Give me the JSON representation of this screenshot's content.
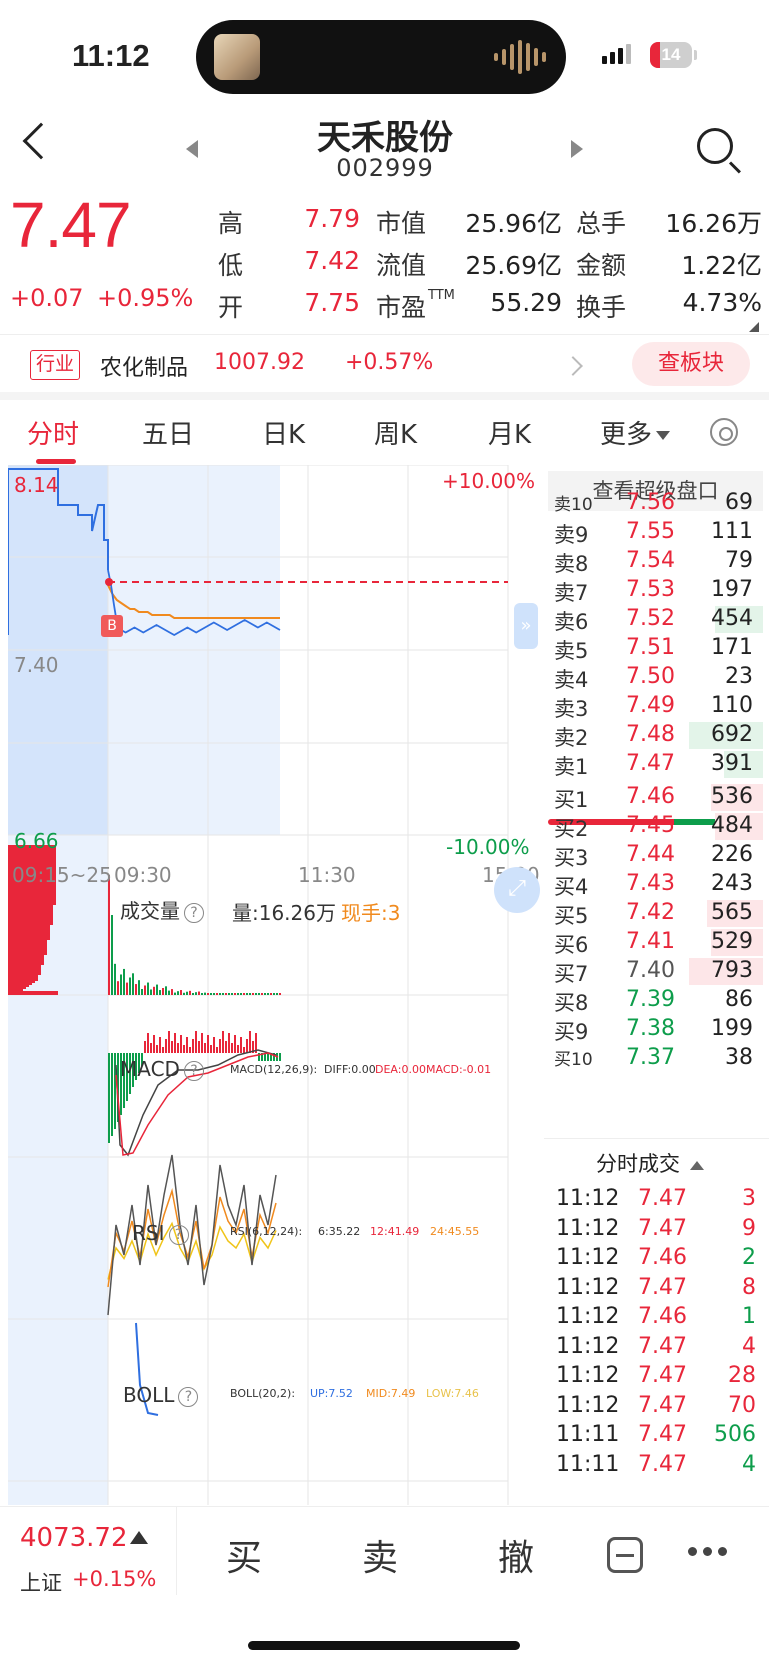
{
  "status": {
    "time": "11:12",
    "battery": "14"
  },
  "header": {
    "title": "天禾股份",
    "code": "002999"
  },
  "quote": {
    "price": "7.47",
    "change": "+0.07",
    "change_pct": "+0.95%",
    "high_label": "高",
    "high": "7.79",
    "low_label": "低",
    "low": "7.42",
    "open_label": "开",
    "open": "7.75",
    "mktcap_label": "市值",
    "mktcap": "25.96亿",
    "float_label": "流值",
    "float": "25.69亿",
    "pe_label": "市盈",
    "pe_sup": "TTM",
    "pe": "55.29",
    "vol_label": "总手",
    "vol": "16.26万",
    "amount_label": "金额",
    "amount": "1.22亿",
    "turnover_label": "换手",
    "turnover": "4.73%"
  },
  "industry": {
    "tag": "行业",
    "name": "农化制品",
    "value": "1007.92",
    "pct": "+0.57%",
    "button": "查板块"
  },
  "tabs": [
    "分时",
    "五日",
    "日K",
    "周K",
    "月K",
    "更多"
  ],
  "chart": {
    "price_top": "8.14",
    "price_mid": "7.40",
    "price_bottom": "6.66",
    "pct_top": "+10.00%",
    "pct_bottom": "-10.00%",
    "time_labels": [
      "09:15~25",
      "09:30",
      "11:30",
      "15:00"
    ],
    "marker": "B",
    "volume_title": "成交量",
    "volume_text": "量:16.26万",
    "now_hand": "现手:3",
    "macd_title": "MACD",
    "macd_params": "MACD(12,26,9):",
    "macd_diff": "DIFF:0.00",
    "macd_dea": "DEA:0.00",
    "macd_val": "MACD:-0.01",
    "rsi_title": "RSI",
    "rsi_params": "RSI(6,12,24):",
    "rsi6": "6:35.22",
    "rsi12": "12:41.49",
    "rsi24": "24:45.55",
    "boll_title": "BOLL",
    "boll_params": "BOLL(20,2):",
    "boll_up": "UP:7.52",
    "boll_mid": "MID:7.49",
    "boll_low": "LOW:7.46",
    "help": "?"
  },
  "chart_data": {
    "type": "line",
    "price_series": [
      7.4,
      7.44,
      7.43,
      7.42,
      7.41,
      7.42,
      7.43,
      7.42,
      7.41,
      7.42,
      7.43,
      7.44,
      7.43,
      7.42,
      7.41,
      7.4,
      7.41,
      7.42,
      7.43,
      7.42,
      7.41,
      7.42,
      7.43,
      7.44,
      7.45,
      7.44,
      7.43,
      7.42,
      7.43,
      7.44,
      7.45,
      7.46,
      7.45,
      7.44,
      7.43,
      7.44,
      7.45,
      7.44,
      7.43,
      7.42
    ],
    "avg_series": [
      7.58,
      7.55,
      7.53,
      7.52,
      7.51,
      7.5,
      7.5,
      7.49,
      7.49,
      7.49,
      7.48,
      7.48,
      7.48,
      7.48,
      7.48,
      7.47,
      7.47,
      7.47,
      7.47,
      7.47,
      7.47,
      7.47,
      7.47,
      7.47,
      7.47,
      7.47,
      7.47,
      7.47,
      7.47,
      7.47,
      7.47,
      7.47,
      7.47,
      7.47,
      7.47,
      7.47,
      7.47,
      7.47,
      7.47,
      7.47
    ],
    "prev_close": 7.4,
    "ylim": [
      6.66,
      8.14
    ]
  },
  "book": {
    "head": "查看超级盘口",
    "asks": [
      {
        "label": "卖10",
        "price": "7.56",
        "vol": "69",
        "color": "red",
        "bar": 0.0
      },
      {
        "label": "卖9",
        "price": "7.55",
        "vol": "111",
        "color": "red",
        "bar": 0.0
      },
      {
        "label": "卖8",
        "price": "7.54",
        "vol": "79",
        "color": "red",
        "bar": 0.0
      },
      {
        "label": "卖7",
        "price": "7.53",
        "vol": "197",
        "color": "red",
        "bar": 0.0
      },
      {
        "label": "卖6",
        "price": "7.52",
        "vol": "454",
        "color": "red",
        "bar": 0.22
      },
      {
        "label": "卖5",
        "price": "7.51",
        "vol": "171",
        "color": "red",
        "bar": 0.0
      },
      {
        "label": "卖4",
        "price": "7.50",
        "vol": "23",
        "color": "red",
        "bar": 0.0
      },
      {
        "label": "卖3",
        "price": "7.49",
        "vol": "110",
        "color": "red",
        "bar": 0.0
      },
      {
        "label": "卖2",
        "price": "7.48",
        "vol": "692",
        "color": "red",
        "bar": 0.34
      },
      {
        "label": "卖1",
        "price": "7.47",
        "vol": "391",
        "color": "red",
        "bar": 0.18
      }
    ],
    "bids": [
      {
        "label": "买1",
        "price": "7.46",
        "vol": "536",
        "color": "red",
        "bar": 0.24
      },
      {
        "label": "买2",
        "price": "7.45",
        "vol": "484",
        "color": "red",
        "bar": 0.22
      },
      {
        "label": "买3",
        "price": "7.44",
        "vol": "226",
        "color": "red",
        "bar": 0.0
      },
      {
        "label": "买4",
        "price": "7.43",
        "vol": "243",
        "color": "red",
        "bar": 0.0
      },
      {
        "label": "买5",
        "price": "7.42",
        "vol": "565",
        "color": "red",
        "bar": 0.26
      },
      {
        "label": "买6",
        "price": "7.41",
        "vol": "529",
        "color": "red",
        "bar": 0.24
      },
      {
        "label": "买7",
        "price": "7.40",
        "vol": "793",
        "color": "gray",
        "bar": 0.34
      },
      {
        "label": "买8",
        "price": "7.39",
        "vol": "86",
        "color": "green",
        "bar": 0.0
      },
      {
        "label": "买9",
        "price": "7.38",
        "vol": "199",
        "color": "green",
        "bar": 0.0
      },
      {
        "label": "买10",
        "price": "7.37",
        "vol": "38",
        "color": "green",
        "bar": 0.0
      }
    ]
  },
  "ticks": {
    "head": "分时成交",
    "rows": [
      {
        "time": "11:12",
        "price": "7.47",
        "vol": "3",
        "pc": "red",
        "vc": "red"
      },
      {
        "time": "11:12",
        "price": "7.47",
        "vol": "9",
        "pc": "red",
        "vc": "red"
      },
      {
        "time": "11:12",
        "price": "7.46",
        "vol": "2",
        "pc": "red",
        "vc": "green"
      },
      {
        "time": "11:12",
        "price": "7.47",
        "vol": "8",
        "pc": "red",
        "vc": "red"
      },
      {
        "time": "11:12",
        "price": "7.46",
        "vol": "1",
        "pc": "red",
        "vc": "green"
      },
      {
        "time": "11:12",
        "price": "7.47",
        "vol": "4",
        "pc": "red",
        "vc": "red"
      },
      {
        "time": "11:12",
        "price": "7.47",
        "vol": "28",
        "pc": "red",
        "vc": "red"
      },
      {
        "time": "11:12",
        "price": "7.47",
        "vol": "70",
        "pc": "red",
        "vc": "red"
      },
      {
        "time": "11:11",
        "price": "7.47",
        "vol": "506",
        "pc": "red",
        "vc": "green"
      },
      {
        "time": "11:11",
        "price": "7.47",
        "vol": "4",
        "pc": "red",
        "vc": "green"
      }
    ]
  },
  "bottom": {
    "index_value": "4073.72",
    "index_name": "上证",
    "index_pct": "+0.15%",
    "buy": "买",
    "sell": "卖",
    "cancel": "撤"
  },
  "colors": {
    "red": "#e8263a",
    "green": "#0d9d4b",
    "blue": "#2f6fe0",
    "orange": "#f08a1e"
  }
}
